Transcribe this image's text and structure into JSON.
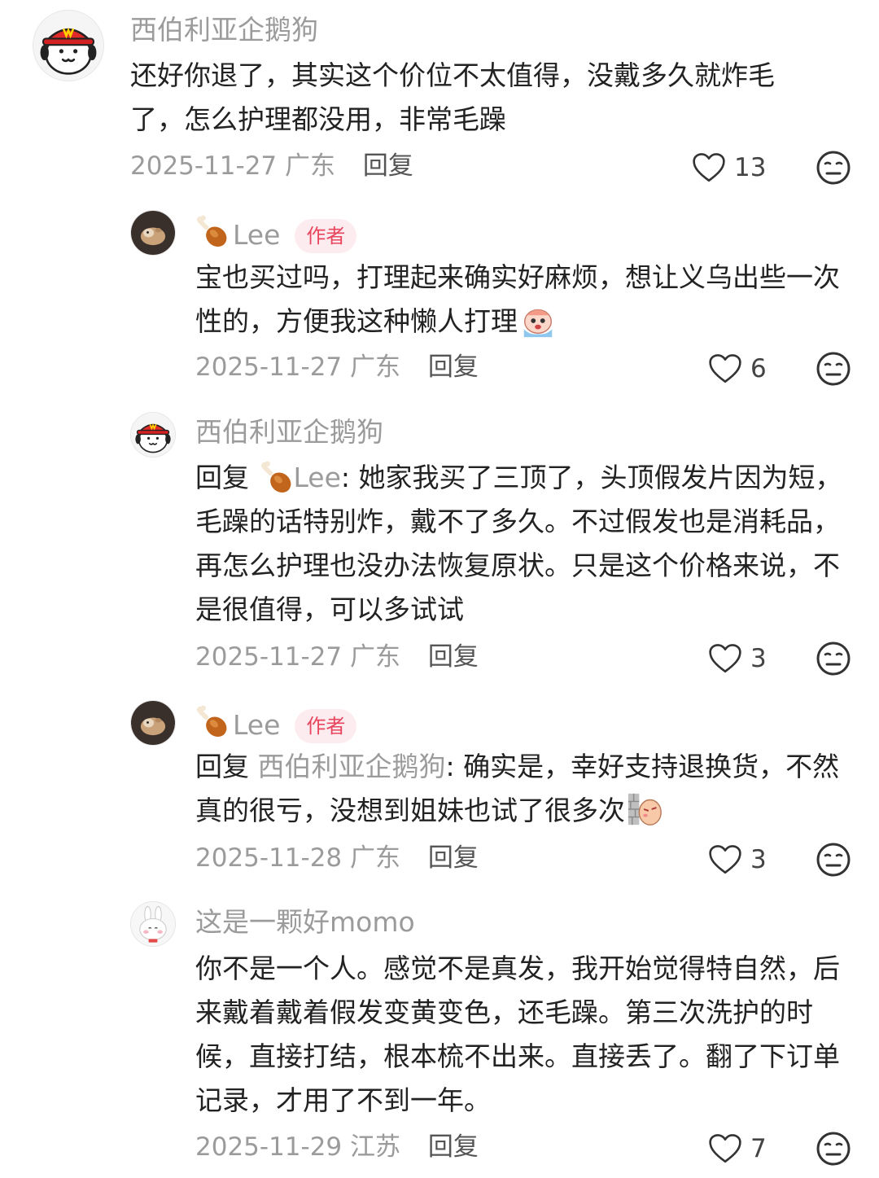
{
  "comments": [
    {
      "username": "西伯利亚企鹅狗",
      "text": "还好你退了，其实这个价位不太值得，没戴多久就炸毛了，怎么护理都没用，非常毛躁",
      "date": "2025-11-27",
      "location": "广东",
      "reply_label": "回复",
      "likes": "13"
    },
    {
      "username": "Lee",
      "badge": "作者",
      "text": "宝也买过吗，打理起来确实好麻烦，想让义乌出些一次性的，方便我这种懒人打理",
      "date": "2025-11-27",
      "location": "广东",
      "reply_label": "回复",
      "likes": "6"
    },
    {
      "username": "西伯利亚企鹅狗",
      "reply_prefix": "回复",
      "reply_target": "Lee",
      "text": ": 她家我买了三顶了，头顶假发片因为短，毛躁的话特别炸，戴不了多久。不过假发也是消耗品，再怎么护理也没办法恢复原状。只是这个价格来说，不是很值得，可以多试试",
      "date": "2025-11-27",
      "location": "广东",
      "reply_label": "回复",
      "likes": "3"
    },
    {
      "username": "Lee",
      "badge": "作者",
      "reply_prefix": "回复",
      "reply_target": "西伯利亚企鹅狗",
      "text": ": 确实是，幸好支持退换货，不然真的很亏，没想到姐妹也试了很多次",
      "date": "2025-11-28",
      "location": "广东",
      "reply_label": "回复",
      "likes": "3"
    },
    {
      "username": "这是一颗好momo",
      "text": "你不是一个人。感觉不是真发，我开始觉得特自然，后来戴着戴着假发变黄变色，还毛躁。第三次洗护的时候，直接打结，根本梳不出来。直接丢了。翻了下订单记录，才用了不到一年。",
      "date": "2025-11-29",
      "location": "江苏",
      "reply_label": "回复",
      "likes": "7"
    }
  ],
  "colors": {
    "muted": "#9b9b9b",
    "badge_bg": "#fdecef",
    "badge_fg": "#e8455f"
  }
}
